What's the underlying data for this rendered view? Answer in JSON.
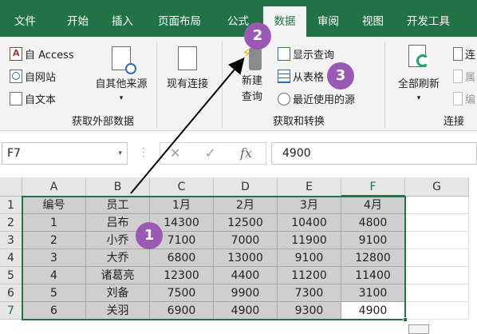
{
  "tabs": [
    "文件",
    "开始",
    "插入",
    "页面布局",
    "公式",
    "数据",
    "审阅",
    "视图",
    "开发工具"
  ],
  "ribbon": {
    "get_external": {
      "access": "自 Access",
      "web": "自网站",
      "text": "自文本",
      "other_sources": "自其他来源",
      "label": "获取外部数据"
    },
    "existing_connections": "现有连接",
    "new_query_line1": "新建",
    "new_query_line2": "查询",
    "show_queries": "显示查询",
    "from_table": "从表格",
    "recent_sources": "最近使用的源",
    "get_transform_label": "获取和转换",
    "refresh_all": "全部刷新",
    "connections_partial": "连",
    "properties_partial": "属",
    "edit_links_partial": "编",
    "connections_label": "连接"
  },
  "formula_bar": {
    "name_box": "F7",
    "fx": "fx",
    "value": "4900"
  },
  "sheet": {
    "columns": [
      "A",
      "B",
      "C",
      "D",
      "E",
      "F",
      "G"
    ],
    "rows": [
      "1",
      "2",
      "3",
      "4",
      "5",
      "6",
      "7"
    ],
    "cells": [
      [
        "编号",
        "员工",
        "1月",
        "2月",
        "3月",
        "4月"
      ],
      [
        "1",
        "吕布",
        "14300",
        "12500",
        "10400",
        "4800"
      ],
      [
        "2",
        "小乔",
        "7100",
        "7000",
        "11900",
        "9100"
      ],
      [
        "3",
        "大乔",
        "6800",
        "13000",
        "9100",
        "12800"
      ],
      [
        "4",
        "诸葛亮",
        "12300",
        "4400",
        "11200",
        "11400"
      ],
      [
        "5",
        "刘备",
        "7500",
        "9900",
        "7300",
        "3100"
      ],
      [
        "6",
        "关羽",
        "6900",
        "4900",
        "9300",
        "4900"
      ]
    ]
  },
  "annotations": [
    "1",
    "2",
    "3"
  ],
  "colors": {
    "excel_green": "#217346",
    "callout_purple": "#9b59b6",
    "selection_border": "#217346"
  }
}
